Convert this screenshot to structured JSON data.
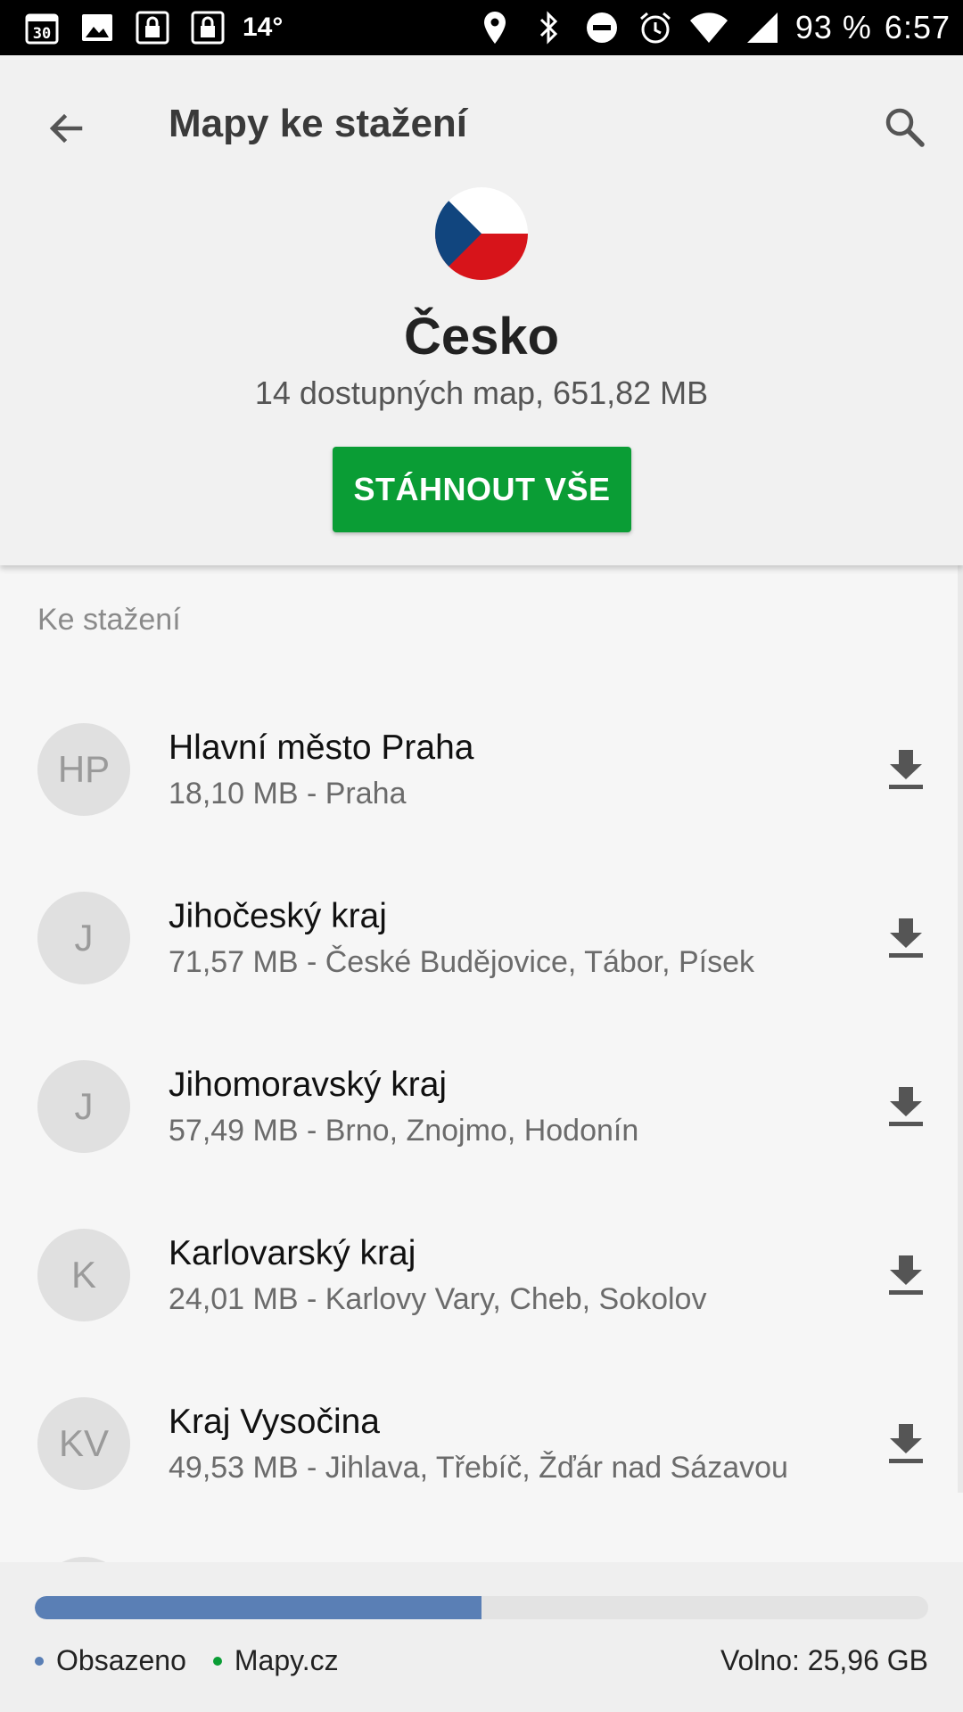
{
  "status_bar": {
    "calendar_day": "30",
    "temperature": "14°",
    "battery": "93 %",
    "time": "6:57",
    "icons": [
      "calendar-icon",
      "image-icon",
      "lock-icon",
      "lock-icon",
      "location-icon",
      "bluetooth-icon",
      "do-not-disturb-icon",
      "alarm-icon",
      "wifi-icon",
      "signal-icon"
    ]
  },
  "header": {
    "title": "Mapy ke stažení",
    "country": "Česko",
    "info": "14 dostupných map, 651,82 MB",
    "download_all_label": "STÁHNOUT VŠE"
  },
  "list": {
    "section_heading": "Ke stažení",
    "items": [
      {
        "initials": "HP",
        "title": "Hlavní město Praha",
        "subtitle": "18,10 MB - Praha"
      },
      {
        "initials": "J",
        "title": "Jihočeský kraj",
        "subtitle": "71,57 MB - České Budějovice, Tábor, Písek"
      },
      {
        "initials": "J",
        "title": "Jihomoravský kraj",
        "subtitle": "57,49 MB - Brno, Znojmo, Hodonín"
      },
      {
        "initials": "K",
        "title": "Karlovarský kraj",
        "subtitle": "24,01 MB - Karlovy Vary, Cheb, Sokolov"
      },
      {
        "initials": "KV",
        "title": "Kraj Vysočina",
        "subtitle": "49,53 MB - Jihlava, Třebíč, Žďár nad Sázavou"
      }
    ]
  },
  "storage": {
    "used_fraction": 0.5,
    "used_label": "Obsazeno",
    "app_label": "Mapy.cz",
    "free_label": "Volno: 25,96 GB",
    "colors": {
      "used": "#5a7fb5",
      "app": "#0a9d35",
      "empty": "#e3e3e3"
    }
  },
  "colors": {
    "accent": "#0a9d35",
    "flag_blue": "#11457e",
    "flag_red": "#d7141a"
  }
}
